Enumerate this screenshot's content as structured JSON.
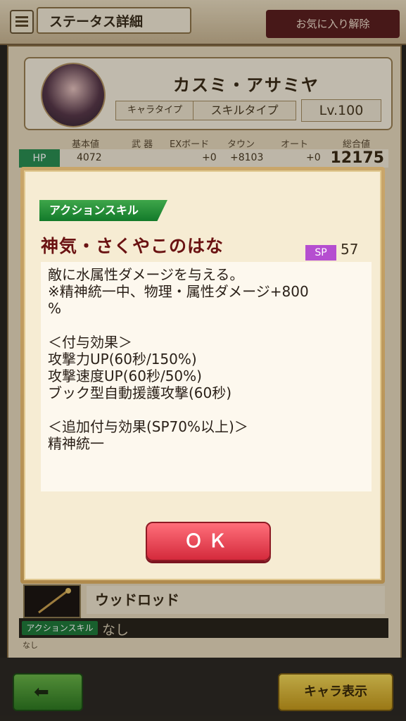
{
  "header": {
    "title": "ステータス詳細",
    "favorite_label": "お気に入り解除"
  },
  "character": {
    "name": "カスミ・アサミヤ",
    "type_label": "キャラタイプ",
    "skill_type_label": "スキルタイプ",
    "level": "Lv.100"
  },
  "stats": {
    "headers": [
      "基本値",
      "武 器",
      "EXボード",
      "タウン",
      "オート",
      "総合値"
    ],
    "hp": {
      "label": "HP",
      "base": "4072",
      "ex": "+0",
      "town": "+8103",
      "auto": "+0",
      "total": "12175"
    }
  },
  "weapon": {
    "name": "ウッドロッド"
  },
  "bottom_skill": {
    "tag": "アクションスキル",
    "value": "なし",
    "sub": "なし"
  },
  "modal": {
    "badge": "アクションスキル",
    "skill_name": "神気・さくやこのはな",
    "sp_label": "SP",
    "sp_value": "57",
    "description": [
      "敵に水属性ダメージを与える。",
      "※精神統一中、物理・属性ダメージ+800",
      "%",
      "",
      "＜付与効果＞",
      "攻撃力UP(60秒/150%)",
      "攻撃速度UP(60秒/50%)",
      "ブック型自動援護攻撃(60秒)",
      "",
      "＜追加付与効果(SP70%以上)＞",
      "精神統一"
    ],
    "ok_label": "ＯＫ"
  },
  "footer": {
    "chara_label": "キャラ表示"
  },
  "colors": {
    "accent_green": "#1f8a3a",
    "sp_purple": "#b54ed0",
    "ok_red": "#e0384a",
    "skill_name": "#6a1212"
  }
}
